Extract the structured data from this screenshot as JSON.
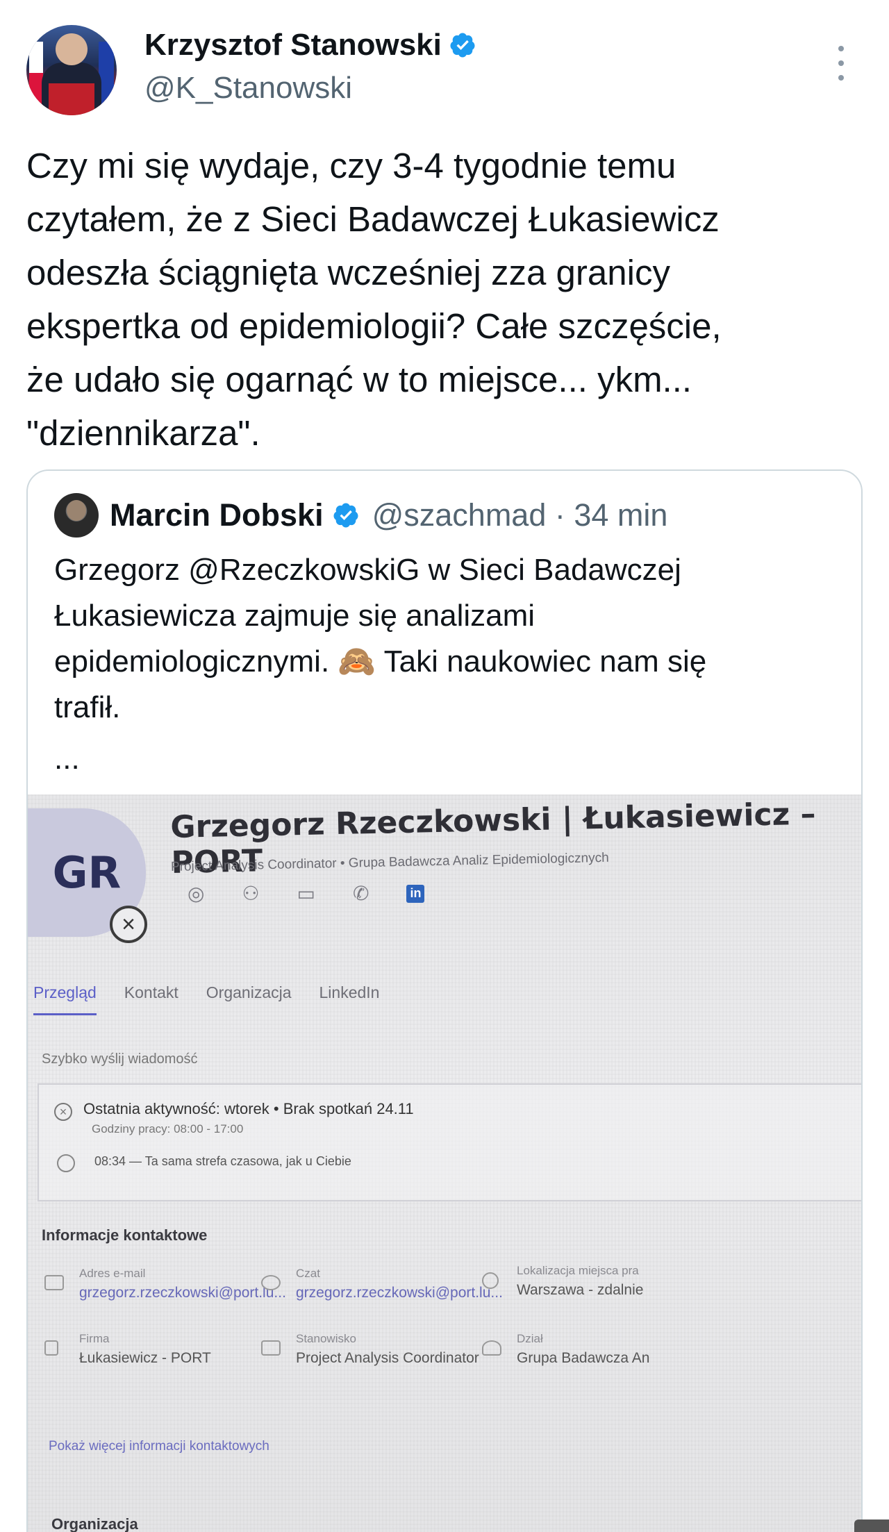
{
  "author": {
    "display_name": "Krzysztof Stanowski",
    "handle": "@K_Stanowski",
    "avatar_icon": "profile-photo",
    "verified_icon": "verified-badge-icon"
  },
  "tweet": {
    "text": "Czy mi się wydaje, czy 3-4 tygodnie temu\nczytałem, że z Sieci Badawczej Łukasiewicz\nodeszła ściągnięta wcześniej zza granicy\nekspertka od epidemiologii? Całe szczęście,\nże udało się ogarnąć w to miejsce... ykm...\n\"dziennikarza\"."
  },
  "quoted": {
    "display_name": "Marcin Dobski",
    "handle_time": "@szachmad · 34 min",
    "text": "Grzegorz @RzeczkowskiG w Sieci Badawczej\nŁukasiewicza zajmuje się analizami\nepidemiologicznymi. 🙈 Taki naukowiec nam się\ntrafił.",
    "ellipsis": "..."
  },
  "photo": {
    "initials": "GR",
    "name": "Grzegorz Rzeczkowski | Łukasiewicz – PORT",
    "subtitle": "Project Analysis Coordinator • Grupa Badawcza Analiz Epidemiologicznych",
    "linkedin_label": "in",
    "tabs": [
      "Przegląd",
      "Kontakt",
      "Organizacja",
      "LinkedIn"
    ],
    "quick_message": "Szybko wyślij wiadomość",
    "activity_line": "Ostatnia aktywność: wtorek • Brak spotkań 24.11",
    "work_hours": "Godziny pracy: 08:00 - 17:00",
    "timezone_line": "08:34 — Ta sama strefa czasowa, jak u Ciebie",
    "contact_title": "Informacje kontaktowe",
    "contact": {
      "email_label": "Adres e-mail",
      "email_value": "grzegorz.rzeczkowski@port.lu...",
      "chat_label": "Czat",
      "chat_value": "grzegorz.rzeczkowski@port.lu...",
      "location_label": "Lokalizacja miejsca pra",
      "location_value": "Warszawa - zdalnie",
      "company_label": "Firma",
      "company_value": "Łukasiewicz - PORT",
      "position_label": "Stanowisko",
      "position_value": "Project Analysis Coordinator",
      "department_label": "Dział",
      "department_value": "Grupa Badawcza An"
    },
    "more_info": "Pokaż więcej informacji kontaktowych",
    "org_title": "Organizacja"
  },
  "colors": {
    "verified": "#1d9bf0",
    "text": "#0f1419",
    "secondary": "#536471",
    "border": "#cfd9de"
  }
}
